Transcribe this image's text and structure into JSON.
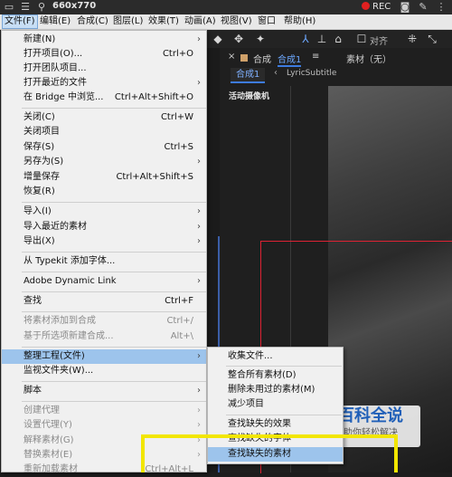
{
  "capture_bar": {
    "size_text": "660x770",
    "rec_label": "REC"
  },
  "menubar": [
    "文件(F)",
    "编辑(E)",
    "合成(C)",
    "图层(L)",
    "效果(T)",
    "动画(A)",
    "视图(V)",
    "窗口",
    "帮助(H)"
  ],
  "toolbar": {
    "align_label": "对齐"
  },
  "comp_panel": {
    "tab_comp": "合成",
    "tab_comp_name": "合成1",
    "tab_source": "素材（无）",
    "subtab_current": "合成1",
    "subtab_layer": "LyricSubtitle",
    "camera_label": "活动摄像机"
  },
  "file_menu": [
    {
      "label": "新建(N)",
      "shortcut": "",
      "submenu": true,
      "disabled": false
    },
    {
      "label": "打开项目(O)...",
      "shortcut": "Ctrl+O",
      "submenu": false,
      "disabled": false
    },
    {
      "label": "打开团队项目...",
      "shortcut": "",
      "submenu": false,
      "disabled": false
    },
    {
      "label": "打开最近的文件",
      "shortcut": "",
      "submenu": true,
      "disabled": false
    },
    {
      "label": "在 Bridge 中浏览...",
      "shortcut": "Ctrl+Alt+Shift+O",
      "submenu": false,
      "disabled": false
    },
    {
      "label": "关闭(C)",
      "shortcut": "Ctrl+W",
      "submenu": false,
      "disabled": false
    },
    {
      "label": "关闭项目",
      "shortcut": "",
      "submenu": false,
      "disabled": false
    },
    {
      "label": "保存(S)",
      "shortcut": "Ctrl+S",
      "submenu": false,
      "disabled": false
    },
    {
      "label": "另存为(S)",
      "shortcut": "",
      "submenu": true,
      "disabled": false
    },
    {
      "label": "增量保存",
      "shortcut": "Ctrl+Alt+Shift+S",
      "submenu": false,
      "disabled": false
    },
    {
      "label": "恢复(R)",
      "shortcut": "",
      "submenu": false,
      "disabled": false
    },
    {
      "label": "导入(I)",
      "shortcut": "",
      "submenu": true,
      "disabled": false
    },
    {
      "label": "导入最近的素材",
      "shortcut": "",
      "submenu": true,
      "disabled": false
    },
    {
      "label": "导出(X)",
      "shortcut": "",
      "submenu": true,
      "disabled": false
    },
    {
      "label": "从 Typekit 添加字体...",
      "shortcut": "",
      "submenu": false,
      "disabled": false
    },
    {
      "label": "Adobe Dynamic Link",
      "shortcut": "",
      "submenu": true,
      "disabled": false
    },
    {
      "label": "查找",
      "shortcut": "Ctrl+F",
      "submenu": false,
      "disabled": false
    },
    {
      "label": "将素材添加到合成",
      "shortcut": "Ctrl+/",
      "submenu": false,
      "disabled": true
    },
    {
      "label": "基于所选项新建合成...",
      "shortcut": "Alt+\\",
      "submenu": false,
      "disabled": true
    },
    {
      "label": "整理工程(文件)",
      "shortcut": "",
      "submenu": true,
      "disabled": false,
      "highlighted": true
    },
    {
      "label": "监视文件夹(W)...",
      "shortcut": "",
      "submenu": false,
      "disabled": false
    },
    {
      "label": "脚本",
      "shortcut": "",
      "submenu": true,
      "disabled": false
    },
    {
      "label": "创建代理",
      "shortcut": "",
      "submenu": true,
      "disabled": true
    },
    {
      "label": "设置代理(Y)",
      "shortcut": "",
      "submenu": true,
      "disabled": true
    },
    {
      "label": "解释素材(G)",
      "shortcut": "",
      "submenu": true,
      "disabled": true
    },
    {
      "label": "替换素材(E)",
      "shortcut": "",
      "submenu": true,
      "disabled": true
    },
    {
      "label": "重新加载素材",
      "shortcut": "Ctrl+Alt+L",
      "submenu": false,
      "disabled": true
    }
  ],
  "submenu": [
    {
      "label": "收集文件...",
      "highlighted": false
    },
    {
      "label": "整合所有素材(D)",
      "highlighted": false
    },
    {
      "label": "删除未用过的素材(M)",
      "highlighted": false
    },
    {
      "label": "减少项目",
      "highlighted": false
    },
    {
      "label": "查找缺失的效果",
      "highlighted": false
    },
    {
      "label": "查找缺失的字体",
      "highlighted": false
    },
    {
      "label": "查找缺失的素材",
      "highlighted": true
    }
  ],
  "watermark": {
    "title": "百科全说",
    "subtitle": "助你轻松解决"
  }
}
